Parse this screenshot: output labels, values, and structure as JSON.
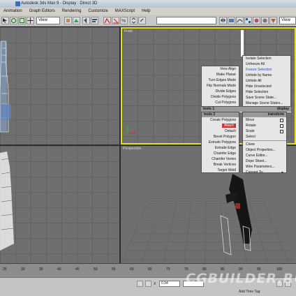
{
  "window": {
    "title": "Autodesk 3ds Max 9     - Display : Direct 3D"
  },
  "menubar": {
    "items": [
      "Animation",
      "Graph Editors",
      "Rendering",
      "Customize",
      "MAXScript",
      "Help"
    ]
  },
  "toolbar": {
    "view_select_1": "View",
    "view_select_2": "View"
  },
  "viewports": {
    "front_label": "Front",
    "perspective_label": "Perspective"
  },
  "quad_left": {
    "top_items": [
      "View Align",
      "Make Planar",
      "Turn Edges Mode",
      "Flip Normals Mode",
      "Divide Edges",
      "Divide Polygons",
      "Cut Polygons"
    ],
    "header": "tools 1",
    "bottom_header": "tools 2",
    "bottom_items": [
      "Create Polygons",
      "Attach",
      "Detach",
      "Bevel Polygon",
      "Extrude Polygons",
      "Extrude Edge",
      "Chamfer Edge",
      "Chamfer Vertex",
      "Break Vertices",
      "Target Weld"
    ]
  },
  "quad_right": {
    "top_items": [
      "Isolate Selection",
      "Unfreeze All",
      "Freeze Selection",
      "Unhide by Name",
      "Unhide All",
      "Hide Unselected",
      "Hide Selection",
      "Save Scene State...",
      "Manage Scene States..."
    ],
    "header": "display",
    "bottom_header": "transform",
    "bottom_items": [
      "Move",
      "Rotate",
      "Scale",
      "Select",
      "Clone",
      "Object Properties...",
      "Curve Editor...",
      "Dope Sheet...",
      "Wire Parameters...",
      "Convert To:"
    ]
  },
  "timeline": {
    "ticks": [
      "25",
      "30",
      "35",
      "40",
      "45",
      "50",
      "55",
      "60",
      "65",
      "70",
      "75",
      "80",
      "85",
      "90",
      "95",
      "100"
    ]
  },
  "statusbar": {
    "x_label": "X",
    "x_value": "0.94",
    "add_time_tag": "Add Time Tag"
  },
  "watermark": "CGBUILDER.RU",
  "colors": {
    "active_viewport": "#e4e21b",
    "highlight": "#cc3333",
    "freeze_text": "#2a4fd0"
  }
}
